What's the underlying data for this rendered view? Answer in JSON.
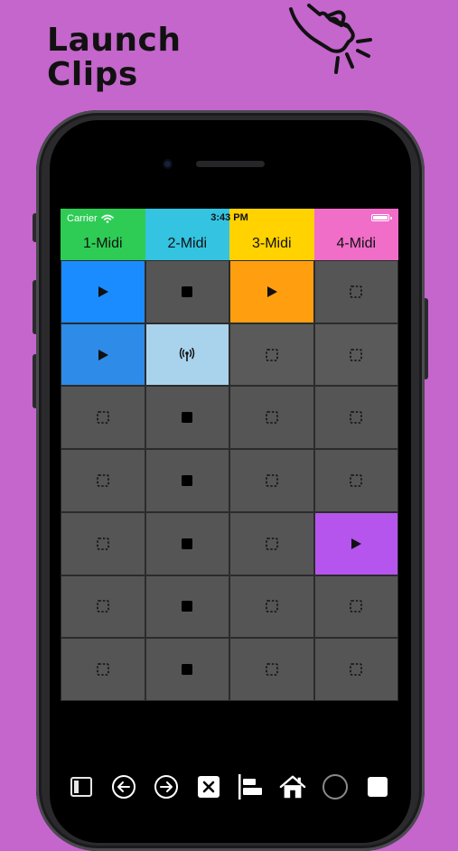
{
  "headline": {
    "line1": "Launch",
    "line2": "Clips"
  },
  "status_bar": {
    "carrier": "Carrier",
    "time": "3:43 PM",
    "icons": [
      "wifi-icon",
      "battery-icon"
    ]
  },
  "tracks": [
    {
      "label": "1-Midi",
      "color": "#2ecc55"
    },
    {
      "label": "2-Midi",
      "color": "#34c3e0"
    },
    {
      "label": "3-Midi",
      "color": "#ffd200"
    },
    {
      "label": "4-Midi",
      "color": "#f06dc8"
    }
  ],
  "grid": [
    [
      {
        "state": "play",
        "color": "#1a8cff"
      },
      {
        "state": "stop",
        "color": "#555555"
      },
      {
        "state": "play",
        "color": "#ff9f10"
      },
      {
        "state": "empty",
        "color": "#555555"
      }
    ],
    [
      {
        "state": "play",
        "color": "#2f8be8"
      },
      {
        "state": "recording",
        "color": "#a9d3ec"
      },
      {
        "state": "empty",
        "color": "#5a5a5a"
      },
      {
        "state": "empty",
        "color": "#5a5a5a"
      }
    ],
    [
      {
        "state": "empty",
        "color": "#555555"
      },
      {
        "state": "stop",
        "color": "#555555"
      },
      {
        "state": "empty",
        "color": "#555555"
      },
      {
        "state": "empty",
        "color": "#555555"
      }
    ],
    [
      {
        "state": "empty",
        "color": "#555555"
      },
      {
        "state": "stop",
        "color": "#555555"
      },
      {
        "state": "empty",
        "color": "#555555"
      },
      {
        "state": "empty",
        "color": "#555555"
      }
    ],
    [
      {
        "state": "empty",
        "color": "#555555"
      },
      {
        "state": "stop",
        "color": "#555555"
      },
      {
        "state": "empty",
        "color": "#555555"
      },
      {
        "state": "play",
        "color": "#b655ee"
      }
    ],
    [
      {
        "state": "empty",
        "color": "#555555"
      },
      {
        "state": "stop",
        "color": "#555555"
      },
      {
        "state": "empty",
        "color": "#555555"
      },
      {
        "state": "empty",
        "color": "#555555"
      }
    ],
    [
      {
        "state": "empty",
        "color": "#555555"
      },
      {
        "state": "stop",
        "color": "#555555"
      },
      {
        "state": "empty",
        "color": "#555555"
      },
      {
        "state": "empty",
        "color": "#555555"
      }
    ]
  ],
  "toolbar": [
    {
      "name": "sidebar-toggle-icon"
    },
    {
      "name": "arrow-left-circle-icon"
    },
    {
      "name": "arrow-right-circle-icon"
    },
    {
      "name": "close-square-icon"
    },
    {
      "name": "align-left-icon"
    },
    {
      "name": "home-icon"
    },
    {
      "name": "circle-icon"
    },
    {
      "name": "square-icon"
    }
  ]
}
